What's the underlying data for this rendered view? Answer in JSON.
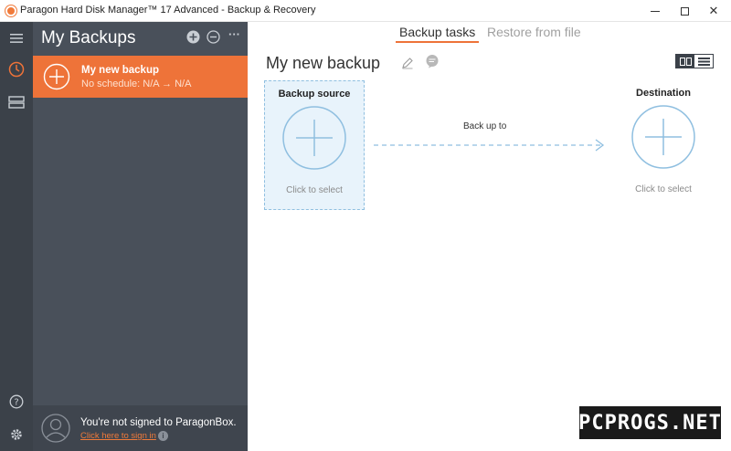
{
  "window": {
    "title": "Paragon Hard Disk Manager™ 17 Advanced - Backup & Recovery",
    "minimize_icon": "minimize-icon",
    "maximize_icon": "maximize-icon",
    "close_label": "✕"
  },
  "rail": {
    "items": [
      {
        "icon": "hamburger-menu-icon"
      },
      {
        "icon": "clock-icon"
      },
      {
        "icon": "drives-icon"
      },
      {
        "icon": "help-icon"
      },
      {
        "icon": "gear-icon"
      }
    ]
  },
  "panel": {
    "title": "My Backups",
    "add_icon": "add-circle-icon",
    "remove_icon": "remove-circle-icon",
    "more_label": "···",
    "items": [
      {
        "name": "My new backup",
        "schedule": "No schedule: N/A → N/A"
      }
    ],
    "account": {
      "status": "You're not signed to ParagonBox.",
      "link": "Click here to sign in",
      "info_label": "i"
    }
  },
  "main": {
    "tabs": [
      {
        "label": "Backup tasks",
        "active": true
      },
      {
        "label": "Restore from file",
        "active": false
      }
    ],
    "title": "My new backup",
    "source": {
      "title": "Backup source",
      "hint": "Click to select"
    },
    "arrow_label": "Back up to",
    "destination": {
      "title": "Destination",
      "hint": "Click to select"
    }
  },
  "watermark": "PCPROGS.NET",
  "colors": {
    "accent": "#ee7339",
    "rail": "#3b4149",
    "panel": "#49505a",
    "selection_blue": "#8fbfe0"
  }
}
